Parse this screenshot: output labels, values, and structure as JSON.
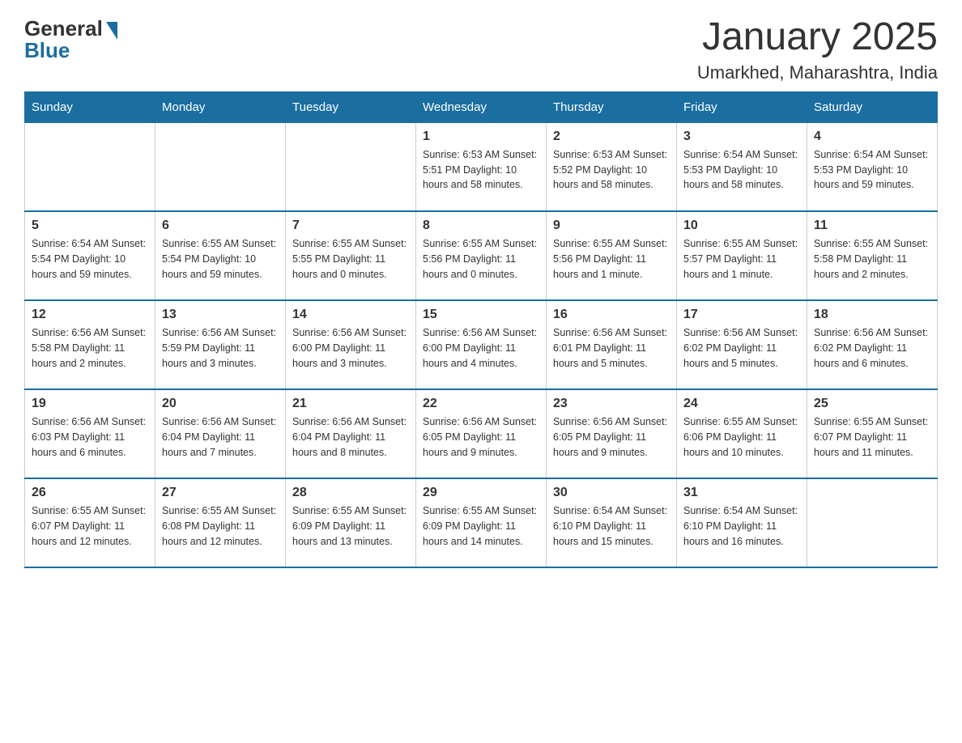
{
  "logo": {
    "general": "General",
    "blue": "Blue"
  },
  "title": "January 2025",
  "subtitle": "Umarkhed, Maharashtra, India",
  "days_header": [
    "Sunday",
    "Monday",
    "Tuesday",
    "Wednesday",
    "Thursday",
    "Friday",
    "Saturday"
  ],
  "weeks": [
    [
      {
        "day": "",
        "info": ""
      },
      {
        "day": "",
        "info": ""
      },
      {
        "day": "",
        "info": ""
      },
      {
        "day": "1",
        "info": "Sunrise: 6:53 AM\nSunset: 5:51 PM\nDaylight: 10 hours\nand 58 minutes."
      },
      {
        "day": "2",
        "info": "Sunrise: 6:53 AM\nSunset: 5:52 PM\nDaylight: 10 hours\nand 58 minutes."
      },
      {
        "day": "3",
        "info": "Sunrise: 6:54 AM\nSunset: 5:53 PM\nDaylight: 10 hours\nand 58 minutes."
      },
      {
        "day": "4",
        "info": "Sunrise: 6:54 AM\nSunset: 5:53 PM\nDaylight: 10 hours\nand 59 minutes."
      }
    ],
    [
      {
        "day": "5",
        "info": "Sunrise: 6:54 AM\nSunset: 5:54 PM\nDaylight: 10 hours\nand 59 minutes."
      },
      {
        "day": "6",
        "info": "Sunrise: 6:55 AM\nSunset: 5:54 PM\nDaylight: 10 hours\nand 59 minutes."
      },
      {
        "day": "7",
        "info": "Sunrise: 6:55 AM\nSunset: 5:55 PM\nDaylight: 11 hours\nand 0 minutes."
      },
      {
        "day": "8",
        "info": "Sunrise: 6:55 AM\nSunset: 5:56 PM\nDaylight: 11 hours\nand 0 minutes."
      },
      {
        "day": "9",
        "info": "Sunrise: 6:55 AM\nSunset: 5:56 PM\nDaylight: 11 hours\nand 1 minute."
      },
      {
        "day": "10",
        "info": "Sunrise: 6:55 AM\nSunset: 5:57 PM\nDaylight: 11 hours\nand 1 minute."
      },
      {
        "day": "11",
        "info": "Sunrise: 6:55 AM\nSunset: 5:58 PM\nDaylight: 11 hours\nand 2 minutes."
      }
    ],
    [
      {
        "day": "12",
        "info": "Sunrise: 6:56 AM\nSunset: 5:58 PM\nDaylight: 11 hours\nand 2 minutes."
      },
      {
        "day": "13",
        "info": "Sunrise: 6:56 AM\nSunset: 5:59 PM\nDaylight: 11 hours\nand 3 minutes."
      },
      {
        "day": "14",
        "info": "Sunrise: 6:56 AM\nSunset: 6:00 PM\nDaylight: 11 hours\nand 3 minutes."
      },
      {
        "day": "15",
        "info": "Sunrise: 6:56 AM\nSunset: 6:00 PM\nDaylight: 11 hours\nand 4 minutes."
      },
      {
        "day": "16",
        "info": "Sunrise: 6:56 AM\nSunset: 6:01 PM\nDaylight: 11 hours\nand 5 minutes."
      },
      {
        "day": "17",
        "info": "Sunrise: 6:56 AM\nSunset: 6:02 PM\nDaylight: 11 hours\nand 5 minutes."
      },
      {
        "day": "18",
        "info": "Sunrise: 6:56 AM\nSunset: 6:02 PM\nDaylight: 11 hours\nand 6 minutes."
      }
    ],
    [
      {
        "day": "19",
        "info": "Sunrise: 6:56 AM\nSunset: 6:03 PM\nDaylight: 11 hours\nand 6 minutes."
      },
      {
        "day": "20",
        "info": "Sunrise: 6:56 AM\nSunset: 6:04 PM\nDaylight: 11 hours\nand 7 minutes."
      },
      {
        "day": "21",
        "info": "Sunrise: 6:56 AM\nSunset: 6:04 PM\nDaylight: 11 hours\nand 8 minutes."
      },
      {
        "day": "22",
        "info": "Sunrise: 6:56 AM\nSunset: 6:05 PM\nDaylight: 11 hours\nand 9 minutes."
      },
      {
        "day": "23",
        "info": "Sunrise: 6:56 AM\nSunset: 6:05 PM\nDaylight: 11 hours\nand 9 minutes."
      },
      {
        "day": "24",
        "info": "Sunrise: 6:55 AM\nSunset: 6:06 PM\nDaylight: 11 hours\nand 10 minutes."
      },
      {
        "day": "25",
        "info": "Sunrise: 6:55 AM\nSunset: 6:07 PM\nDaylight: 11 hours\nand 11 minutes."
      }
    ],
    [
      {
        "day": "26",
        "info": "Sunrise: 6:55 AM\nSunset: 6:07 PM\nDaylight: 11 hours\nand 12 minutes."
      },
      {
        "day": "27",
        "info": "Sunrise: 6:55 AM\nSunset: 6:08 PM\nDaylight: 11 hours\nand 12 minutes."
      },
      {
        "day": "28",
        "info": "Sunrise: 6:55 AM\nSunset: 6:09 PM\nDaylight: 11 hours\nand 13 minutes."
      },
      {
        "day": "29",
        "info": "Sunrise: 6:55 AM\nSunset: 6:09 PM\nDaylight: 11 hours\nand 14 minutes."
      },
      {
        "day": "30",
        "info": "Sunrise: 6:54 AM\nSunset: 6:10 PM\nDaylight: 11 hours\nand 15 minutes."
      },
      {
        "day": "31",
        "info": "Sunrise: 6:54 AM\nSunset: 6:10 PM\nDaylight: 11 hours\nand 16 minutes."
      },
      {
        "day": "",
        "info": ""
      }
    ]
  ]
}
